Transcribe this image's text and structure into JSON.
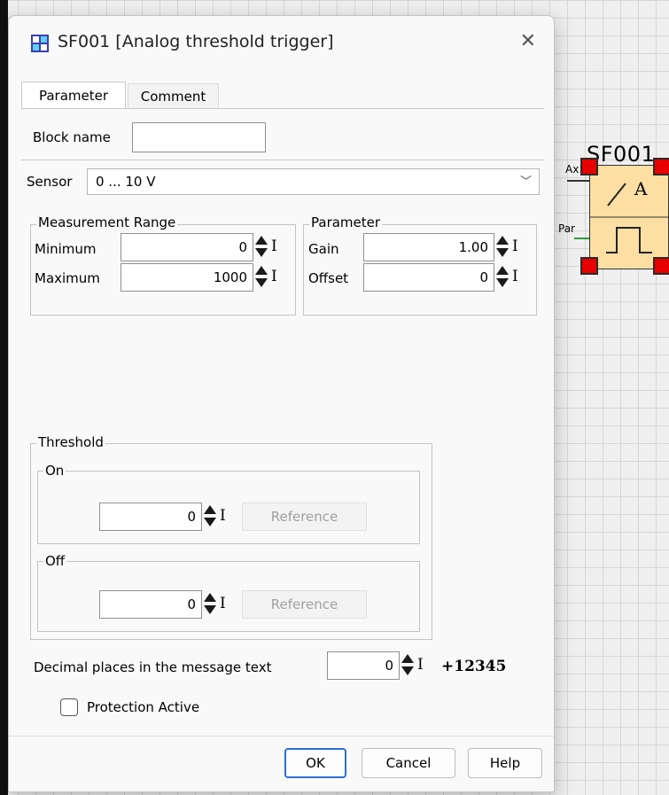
{
  "canvas_block": {
    "title": "SF001",
    "port_ax": "Ax",
    "port_par": "Par",
    "symbol_letter": "A",
    "pin_color": "#e60000",
    "body_color": "#fddfa3"
  },
  "dialog": {
    "title": "SF001 [Analog threshold trigger]",
    "close_glyph": "✕",
    "tabs": [
      {
        "label": "Parameter",
        "active": true
      },
      {
        "label": "Comment",
        "active": false
      }
    ],
    "block_name": {
      "label": "Block name",
      "value": ""
    },
    "sensor": {
      "label": "Sensor",
      "value": "0 ... 10 V",
      "arrow": "﹀"
    },
    "measurement_range": {
      "title": "Measurement Range",
      "minimum_label": "Minimum",
      "minimum_value": "0",
      "maximum_label": "Maximum",
      "maximum_value": "1000"
    },
    "parameter": {
      "title": "Parameter",
      "gain_label": "Gain",
      "gain_value": "1.00",
      "offset_label": "Offset",
      "offset_value": "0"
    },
    "threshold": {
      "title": "Threshold",
      "on": {
        "title": "On",
        "value": "0",
        "reference_label": "Reference"
      },
      "off": {
        "title": "Off",
        "value": "0",
        "reference_label": "Reference"
      }
    },
    "decimal_places": {
      "label": "Decimal places in the message text",
      "value": "0",
      "sample": "+12345"
    },
    "protection": {
      "label": "Protection Active",
      "checked": false
    },
    "ibeam_glyph": "I",
    "buttons": {
      "ok": "OK",
      "cancel": "Cancel",
      "help": "Help"
    },
    "accent_color": "#2b6fd6"
  }
}
